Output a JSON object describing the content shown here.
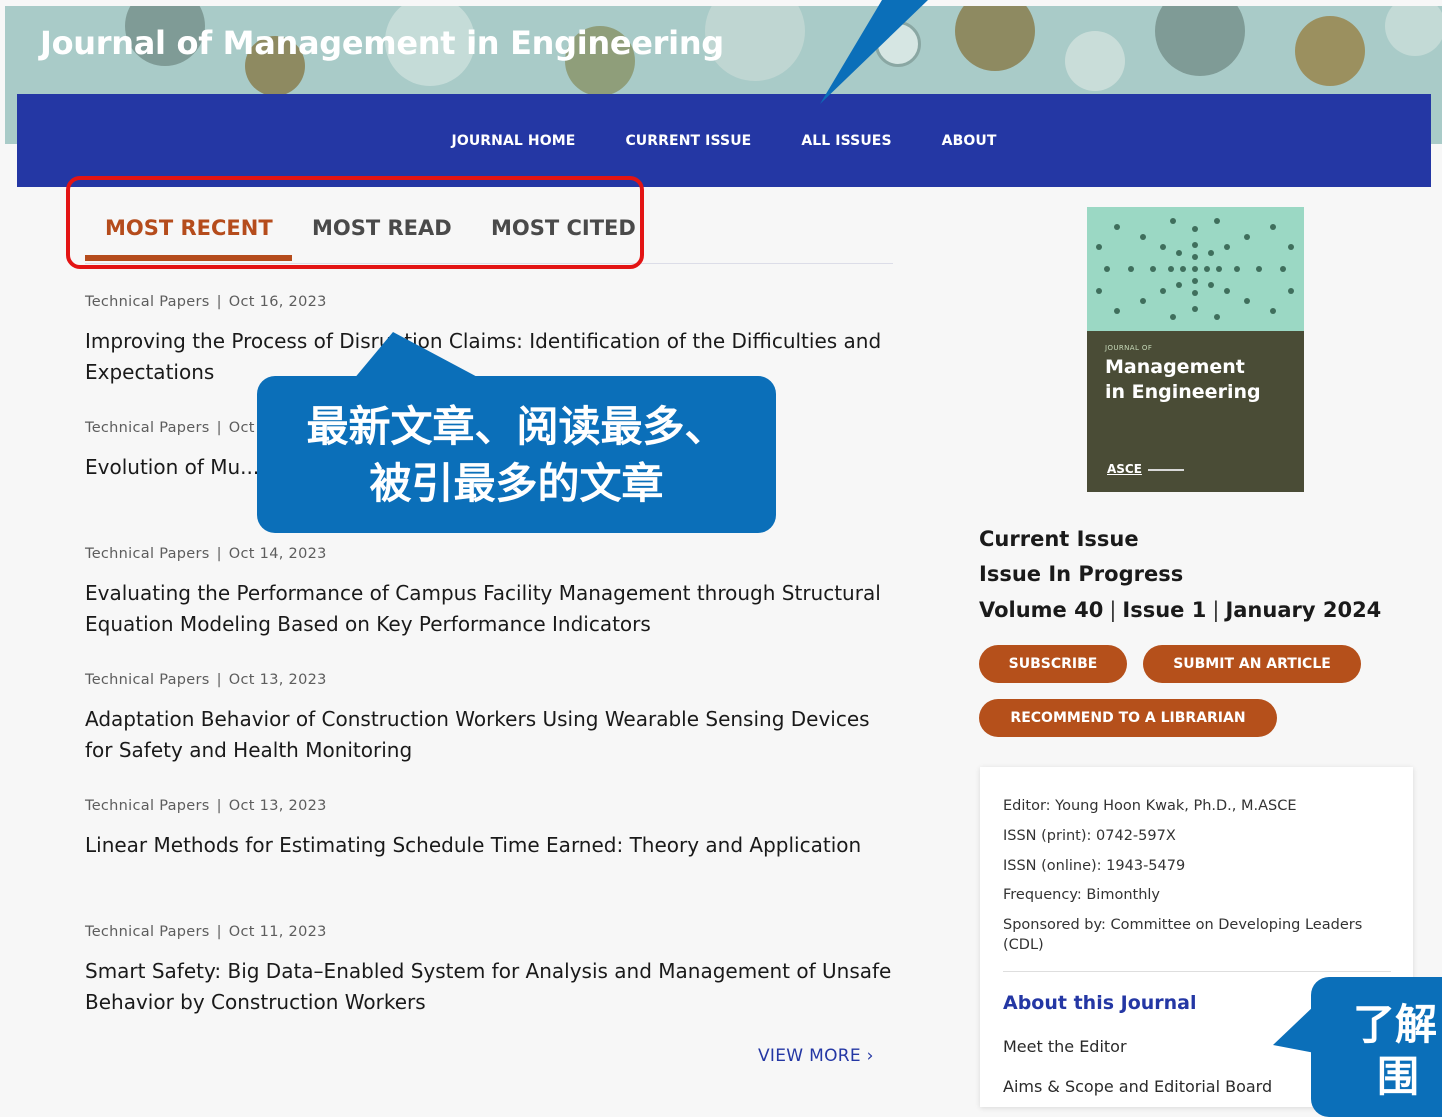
{
  "header": {
    "journal_title": "Journal of Management in Engineering",
    "nav": [
      "JOURNAL HOME",
      "CURRENT ISSUE",
      "ALL ISSUES",
      "ABOUT"
    ],
    "nav_bg": "#2437a4"
  },
  "tabs": {
    "items": [
      "MOST RECENT",
      "MOST READ",
      "MOST CITED"
    ],
    "active": "MOST RECENT",
    "accent": "#b54c1c"
  },
  "articles": [
    {
      "type": "Technical Papers",
      "date": "Oct 16, 2023",
      "title": "Improving the Process of Disruption Claims: Identification of the Difficulties and Expectations"
    },
    {
      "type": "Technical Papers",
      "date": "Oct 14, 2023",
      "title": "Evolution of Mu...of Certification in..."
    },
    {
      "type": "Technical Papers",
      "date": "Oct 14, 2023",
      "title": "Evaluating the Performance of Campus Facility Management through Structural Equation Modeling Based on Key Performance Indicators"
    },
    {
      "type": "Technical Papers",
      "date": "Oct 13, 2023",
      "title": "Adaptation Behavior of Construction Workers Using Wearable Sensing Devices for Safety and Health Monitoring"
    },
    {
      "type": "Technical Papers",
      "date": "Oct 13, 2023",
      "title": "Linear Methods for Estimating Schedule Time Earned: Theory and Application"
    },
    {
      "type": "Technical Papers",
      "date": "Oct 11, 2023",
      "title": "Smart Safety: Big Data–Enabled System for Analysis and Management of Unsafe Behavior by Construction Workers"
    }
  ],
  "view_more": "VIEW MORE",
  "callout_main": {
    "line1": "最新文章、阅读最多、",
    "line2": "被引最多的文章",
    "color": "#0b6fb9"
  },
  "callout_side": {
    "line1": "了解",
    "line2": "围"
  },
  "cover": {
    "small": "JOURNAL OF",
    "title_line1": "Management",
    "title_line2": "in Engineering",
    "logo": "ASCE"
  },
  "issue": {
    "current": "Current Issue",
    "progress": "Issue In Progress",
    "volume": "Volume 40",
    "number": "Issue 1",
    "date": "January 2024"
  },
  "buttons": {
    "subscribe": "SUBSCRIBE",
    "submit": "SUBMIT AN ARTICLE",
    "recommend": "RECOMMEND TO A LIBRARIAN",
    "color": "#b5501b"
  },
  "info": {
    "editor": "Editor: Young Hoon Kwak, Ph.D., M.ASCE",
    "issn_print": "ISSN (print): 0742-597X",
    "issn_online": "ISSN (online): 1943-5479",
    "frequency": "Frequency: Bimonthly",
    "sponsored": "Sponsored by: Committee on Developing Leaders (CDL)",
    "about_title": "About this Journal",
    "links": [
      "Meet the Editor",
      "Aims & Scope and Editorial Board"
    ]
  }
}
